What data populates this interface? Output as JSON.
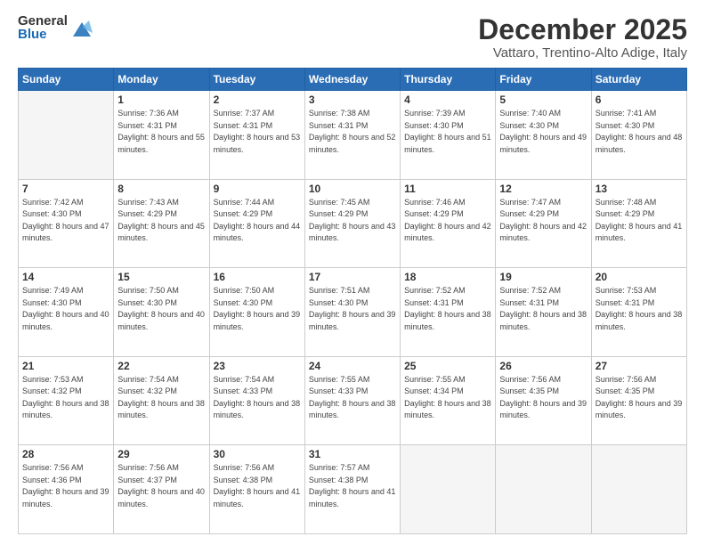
{
  "logo": {
    "general": "General",
    "blue": "Blue"
  },
  "title": "December 2025",
  "location": "Vattaro, Trentino-Alto Adige, Italy",
  "days_of_week": [
    "Sunday",
    "Monday",
    "Tuesday",
    "Wednesday",
    "Thursday",
    "Friday",
    "Saturday"
  ],
  "weeks": [
    [
      {
        "day": "",
        "sunrise": "",
        "sunset": "",
        "daylight": "",
        "empty": true
      },
      {
        "day": "1",
        "sunrise": "Sunrise: 7:36 AM",
        "sunset": "Sunset: 4:31 PM",
        "daylight": "Daylight: 8 hours and 55 minutes."
      },
      {
        "day": "2",
        "sunrise": "Sunrise: 7:37 AM",
        "sunset": "Sunset: 4:31 PM",
        "daylight": "Daylight: 8 hours and 53 minutes."
      },
      {
        "day": "3",
        "sunrise": "Sunrise: 7:38 AM",
        "sunset": "Sunset: 4:31 PM",
        "daylight": "Daylight: 8 hours and 52 minutes."
      },
      {
        "day": "4",
        "sunrise": "Sunrise: 7:39 AM",
        "sunset": "Sunset: 4:30 PM",
        "daylight": "Daylight: 8 hours and 51 minutes."
      },
      {
        "day": "5",
        "sunrise": "Sunrise: 7:40 AM",
        "sunset": "Sunset: 4:30 PM",
        "daylight": "Daylight: 8 hours and 49 minutes."
      },
      {
        "day": "6",
        "sunrise": "Sunrise: 7:41 AM",
        "sunset": "Sunset: 4:30 PM",
        "daylight": "Daylight: 8 hours and 48 minutes."
      }
    ],
    [
      {
        "day": "7",
        "sunrise": "Sunrise: 7:42 AM",
        "sunset": "Sunset: 4:30 PM",
        "daylight": "Daylight: 8 hours and 47 minutes."
      },
      {
        "day": "8",
        "sunrise": "Sunrise: 7:43 AM",
        "sunset": "Sunset: 4:29 PM",
        "daylight": "Daylight: 8 hours and 45 minutes."
      },
      {
        "day": "9",
        "sunrise": "Sunrise: 7:44 AM",
        "sunset": "Sunset: 4:29 PM",
        "daylight": "Daylight: 8 hours and 44 minutes."
      },
      {
        "day": "10",
        "sunrise": "Sunrise: 7:45 AM",
        "sunset": "Sunset: 4:29 PM",
        "daylight": "Daylight: 8 hours and 43 minutes."
      },
      {
        "day": "11",
        "sunrise": "Sunrise: 7:46 AM",
        "sunset": "Sunset: 4:29 PM",
        "daylight": "Daylight: 8 hours and 42 minutes."
      },
      {
        "day": "12",
        "sunrise": "Sunrise: 7:47 AM",
        "sunset": "Sunset: 4:29 PM",
        "daylight": "Daylight: 8 hours and 42 minutes."
      },
      {
        "day": "13",
        "sunrise": "Sunrise: 7:48 AM",
        "sunset": "Sunset: 4:29 PM",
        "daylight": "Daylight: 8 hours and 41 minutes."
      }
    ],
    [
      {
        "day": "14",
        "sunrise": "Sunrise: 7:49 AM",
        "sunset": "Sunset: 4:30 PM",
        "daylight": "Daylight: 8 hours and 40 minutes."
      },
      {
        "day": "15",
        "sunrise": "Sunrise: 7:50 AM",
        "sunset": "Sunset: 4:30 PM",
        "daylight": "Daylight: 8 hours and 40 minutes."
      },
      {
        "day": "16",
        "sunrise": "Sunrise: 7:50 AM",
        "sunset": "Sunset: 4:30 PM",
        "daylight": "Daylight: 8 hours and 39 minutes."
      },
      {
        "day": "17",
        "sunrise": "Sunrise: 7:51 AM",
        "sunset": "Sunset: 4:30 PM",
        "daylight": "Daylight: 8 hours and 39 minutes."
      },
      {
        "day": "18",
        "sunrise": "Sunrise: 7:52 AM",
        "sunset": "Sunset: 4:31 PM",
        "daylight": "Daylight: 8 hours and 38 minutes."
      },
      {
        "day": "19",
        "sunrise": "Sunrise: 7:52 AM",
        "sunset": "Sunset: 4:31 PM",
        "daylight": "Daylight: 8 hours and 38 minutes."
      },
      {
        "day": "20",
        "sunrise": "Sunrise: 7:53 AM",
        "sunset": "Sunset: 4:31 PM",
        "daylight": "Daylight: 8 hours and 38 minutes."
      }
    ],
    [
      {
        "day": "21",
        "sunrise": "Sunrise: 7:53 AM",
        "sunset": "Sunset: 4:32 PM",
        "daylight": "Daylight: 8 hours and 38 minutes."
      },
      {
        "day": "22",
        "sunrise": "Sunrise: 7:54 AM",
        "sunset": "Sunset: 4:32 PM",
        "daylight": "Daylight: 8 hours and 38 minutes."
      },
      {
        "day": "23",
        "sunrise": "Sunrise: 7:54 AM",
        "sunset": "Sunset: 4:33 PM",
        "daylight": "Daylight: 8 hours and 38 minutes."
      },
      {
        "day": "24",
        "sunrise": "Sunrise: 7:55 AM",
        "sunset": "Sunset: 4:33 PM",
        "daylight": "Daylight: 8 hours and 38 minutes."
      },
      {
        "day": "25",
        "sunrise": "Sunrise: 7:55 AM",
        "sunset": "Sunset: 4:34 PM",
        "daylight": "Daylight: 8 hours and 38 minutes."
      },
      {
        "day": "26",
        "sunrise": "Sunrise: 7:56 AM",
        "sunset": "Sunset: 4:35 PM",
        "daylight": "Daylight: 8 hours and 39 minutes."
      },
      {
        "day": "27",
        "sunrise": "Sunrise: 7:56 AM",
        "sunset": "Sunset: 4:35 PM",
        "daylight": "Daylight: 8 hours and 39 minutes."
      }
    ],
    [
      {
        "day": "28",
        "sunrise": "Sunrise: 7:56 AM",
        "sunset": "Sunset: 4:36 PM",
        "daylight": "Daylight: 8 hours and 39 minutes."
      },
      {
        "day": "29",
        "sunrise": "Sunrise: 7:56 AM",
        "sunset": "Sunset: 4:37 PM",
        "daylight": "Daylight: 8 hours and 40 minutes."
      },
      {
        "day": "30",
        "sunrise": "Sunrise: 7:56 AM",
        "sunset": "Sunset: 4:38 PM",
        "daylight": "Daylight: 8 hours and 41 minutes."
      },
      {
        "day": "31",
        "sunrise": "Sunrise: 7:57 AM",
        "sunset": "Sunset: 4:38 PM",
        "daylight": "Daylight: 8 hours and 41 minutes."
      },
      {
        "day": "",
        "sunrise": "",
        "sunset": "",
        "daylight": "",
        "empty": true
      },
      {
        "day": "",
        "sunrise": "",
        "sunset": "",
        "daylight": "",
        "empty": true
      },
      {
        "day": "",
        "sunrise": "",
        "sunset": "",
        "daylight": "",
        "empty": true
      }
    ]
  ]
}
